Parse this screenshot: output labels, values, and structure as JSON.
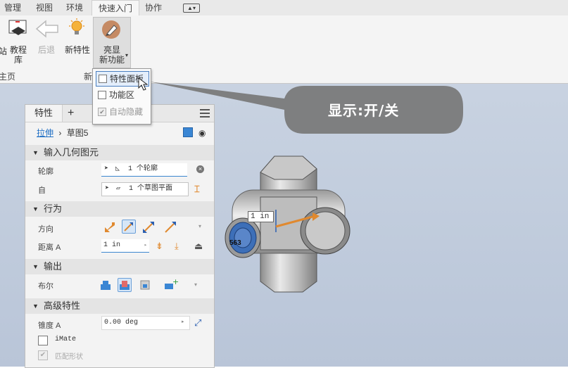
{
  "tabs": [
    "管理",
    "视图",
    "环境",
    "快速入门",
    "协作"
  ],
  "active_tab": "快速入门",
  "ribbon": {
    "buttons": [
      {
        "label": "教程\n库",
        "key": "tutorial"
      },
      {
        "label": "后退",
        "key": "back"
      },
      {
        "label": "新特性",
        "key": "new_features"
      },
      {
        "label": "亮显\n新功能",
        "key": "highlight_new"
      }
    ],
    "panel_labels": [
      "主页",
      "新"
    ],
    "cut_left_label": "站"
  },
  "dropdown": {
    "items": [
      {
        "label": "特性面板",
        "checked": false,
        "highlighted": true,
        "disabled": false
      },
      {
        "label": "功能区",
        "checked": false,
        "highlighted": false,
        "disabled": false
      },
      {
        "label": "自动隐藏",
        "checked": true,
        "highlighted": false,
        "disabled": true
      }
    ]
  },
  "callout": {
    "text": "显示:开/关"
  },
  "property_panel": {
    "tab_label": "特性",
    "add_tab": "+",
    "breadcrumb": {
      "link": "拉伸",
      "separator": "›",
      "current": "草图5"
    },
    "sections": {
      "input_geometry": "输入几何图元",
      "behavior": "行为",
      "output": "输出",
      "advanced": "高级特性"
    },
    "fields": {
      "profile_label": "轮廓",
      "profile_value": "1 个轮廓",
      "from_label": "自",
      "from_value": "1 个草图平面",
      "direction_label": "方向",
      "distance_label": "距离 A",
      "distance_value": "1 in",
      "boolean_label": "布尔",
      "taper_label": "锥度 A",
      "taper_value": "0.00 deg",
      "imate_label": "iMate",
      "match_shape_label": "匹配形状"
    }
  },
  "viewport": {
    "dimension_label": "1 in",
    "partial_label": "563"
  },
  "colors": {
    "accent": "#3b86d0",
    "callout_bg": "#7a7a7a",
    "arrow_orange": "#e0892f",
    "model_grey": "#a9a9a9",
    "blue_disc": "#3d6fb8"
  }
}
